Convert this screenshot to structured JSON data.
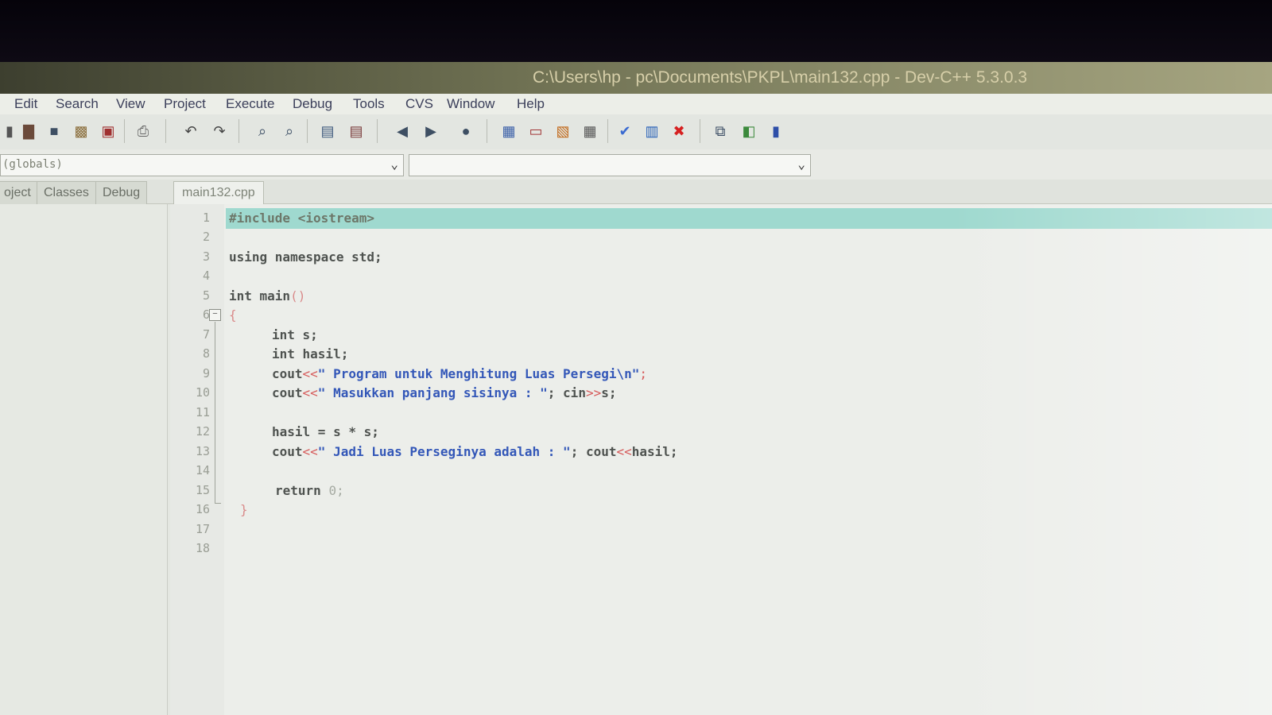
{
  "window": {
    "title": "C:\\Users\\hp - pc\\Documents\\PKPL\\main132.cpp - Dev-C++ 5.3.0.3"
  },
  "menu": [
    "Edit",
    "Search",
    "View",
    "Project",
    "Execute",
    "Debug",
    "Tools",
    "CVS",
    "Window",
    "Help"
  ],
  "toolbar": {
    "icons": [
      "new-file-icon",
      "open-icon",
      "save-icon",
      "save-all-icon",
      "close-icon",
      "print-icon",
      "undo-icon",
      "redo-icon",
      "find-icon",
      "replace-icon",
      "indent-icon",
      "unindent-icon",
      "bookmark-back-icon",
      "bookmark-forward-icon",
      "goto-icon",
      "compile-icon",
      "run-icon",
      "compile-run-icon",
      "rebuild-icon",
      "check-syntax-icon",
      "chart-icon",
      "stop-icon",
      "new-project-icon",
      "insert-icon",
      "help-icon"
    ]
  },
  "combos": {
    "scope": "(globals)",
    "member": ""
  },
  "panel_tabs": [
    "oject",
    "Classes",
    "Debug"
  ],
  "editor_tab": "main132.cpp",
  "line_numbers": [
    "1",
    "2",
    "3",
    "4",
    "5",
    "6",
    "7",
    "8",
    "9",
    "10",
    "11",
    "12",
    "13",
    "14",
    "15",
    "16",
    "17",
    "18"
  ],
  "code": {
    "l1": "#include <iostream>",
    "l3": "using namespace std;",
    "l5_kw": "int main",
    "l5_paren": "()",
    "l6": "{",
    "l7": "int s;",
    "l8": "int hasil;",
    "l9_a": "cout",
    "l9_op": "<<",
    "l9_str": "\" Program untuk Menghitung Luas Persegi\\n\"",
    "l9_semi": ";",
    "l10_a": "cout",
    "l10_op": "<<",
    "l10_str": "\" Masukkan panjang sisinya : \"",
    "l10_b": "; cin",
    "l10_op2": ">>",
    "l10_c": "s;",
    "l12": "hasil = s * s;",
    "l13_a": "cout",
    "l13_op": "<<",
    "l13_str": "\" Jadi Luas Perseginya adalah : \"",
    "l13_b": "; cout",
    "l13_op2": "<<",
    "l13_c": "hasil;",
    "l15_kw": "return ",
    "l15_num": "0",
    "l15_semi": ";",
    "l16": "}"
  },
  "colors": {
    "highlight": "#9fd9cf",
    "string": "#3357b8",
    "operator": "#d65a5a"
  }
}
